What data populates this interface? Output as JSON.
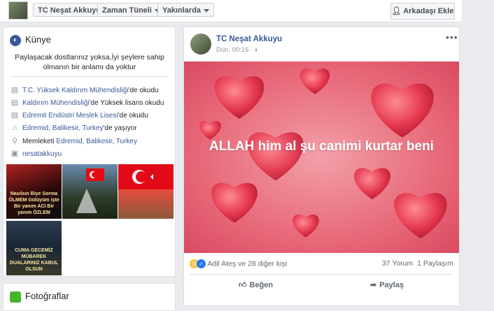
{
  "topbar": {
    "profile_name": "TC Neşat Akkuyu",
    "timeline_label": "Zaman Tüneli",
    "nearby_label": "Yakınlarda",
    "add_friend_label": "Arkadaşı Ekle"
  },
  "kunye": {
    "title": "Künye",
    "bio": "Paylaşacak dostlarınız yoksa,İyi şeylere sahip olmanın bir anlamı da yoktur",
    "items": [
      {
        "icon": "graduation-cap-icon",
        "link": "T.C. Yüksek Kaldırım Mühendisliği",
        "text": "'de okudu"
      },
      {
        "icon": "graduation-cap-icon",
        "link": "Kaldırım Mühendisliği",
        "text": "'de Yüksek lisans okudu"
      },
      {
        "icon": "graduation-cap-icon",
        "link": "Edremit Endüstri Meslek Lisesi",
        "text": "'de okudu"
      },
      {
        "icon": "home-icon",
        "link": "Edremid, Balikesir, Turkey",
        "text": "'de yaşıyor"
      },
      {
        "icon": "location-pin-icon",
        "prefix": "Memleketi ",
        "link": "Edremid, Balikesir, Turkey",
        "text": ""
      },
      {
        "icon": "instagram-icon",
        "link": "nesatakkuyu",
        "text": ""
      }
    ],
    "photo_captions": {
      "t1": "Nasılsın Biye Sorma ÖLMEM Gülüyüm işte Bir yanım ACI Bir yanım ÖZLEM",
      "t4": "CUMA GECEMİZ MÜBAREK DUALARINIZ KABUL OLSUN"
    }
  },
  "fotograflar": {
    "title": "Fotoğraflar"
  },
  "post": {
    "author": "TC Neşat Akkuyu",
    "time": "Dün, 00:16 ·",
    "more": "•••",
    "image_text": "ALLAH him al şu canimi kurtar beni",
    "reactors": "Adil Ateş ve 28 diğer kişi",
    "comments": "37 Yorum",
    "shares": "1 Paylaşım",
    "like_label": "Beğen",
    "share_label": "Paylaş"
  },
  "colors": {
    "link": "#385898",
    "background": "#e9ebee",
    "image_pink": "#e86a7a"
  }
}
